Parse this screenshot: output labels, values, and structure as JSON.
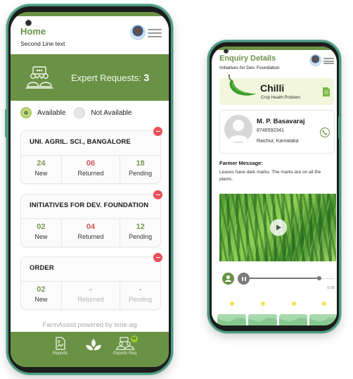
{
  "home_screen": {
    "header": {
      "title": "Home",
      "subtitle": "Second Line text",
      "avatar_icon": "user-avatar",
      "menu_icon": "hamburger-menu-icon"
    },
    "banner": {
      "icon": "expert-group-icon",
      "label": "Expert Requests:",
      "count": "3"
    },
    "availability": {
      "options": [
        {
          "label": "Available",
          "selected": true
        },
        {
          "label": "Not Available",
          "selected": false
        }
      ]
    },
    "organizations": [
      {
        "name": "UNI. AGRIL. SCI., BANGALORE",
        "stats": [
          {
            "value": "24",
            "label": "New"
          },
          {
            "value": "06",
            "label": "Returned"
          },
          {
            "value": "18",
            "label": "Pending"
          }
        ]
      },
      {
        "name": "INITIATIVES FOR DEV. FOUNDATION",
        "stats": [
          {
            "value": "02",
            "label": "New"
          },
          {
            "value": "04",
            "label": "Returned"
          },
          {
            "value": "12",
            "label": "Pending"
          }
        ]
      },
      {
        "name": "ORDER",
        "stats": [
          {
            "value": "02",
            "label": "New"
          },
          {
            "value": "-",
            "label": "Returned"
          },
          {
            "value": "-",
            "label": "Pending"
          }
        ]
      }
    ],
    "footer_brand": "FarmAssist powered by tene-ag",
    "bottom_nav": [
      {
        "label": "Reports",
        "icon": "report-document-icon"
      },
      {
        "label": "",
        "icon": "leaves-icon"
      },
      {
        "label": "Experts Req",
        "icon": "experts-icon",
        "badge": "04"
      }
    ]
  },
  "enquiry_screen": {
    "header": {
      "title": "Enquiry Details",
      "subtitle": "Initiatives for Dev. Foundation",
      "avatar_icon": "user-avatar",
      "menu_icon": "hamburger-menu-icon"
    },
    "crop": {
      "name": "Chilli",
      "problem": "Crop Health Problem",
      "icon": "chilli-icon",
      "doc_icon": "document-icon"
    },
    "farmer": {
      "name": "M. P. Basavaraj",
      "phone": "8746592341",
      "location": "Raichur, Karnataka",
      "call_icon": "phone-icon"
    },
    "message": {
      "title": "Farmer Message:",
      "text": "Leaves have dark marks. The marks are on all the plants."
    },
    "video": {
      "play_icon": "play-icon"
    },
    "audio": {
      "time": "0.05",
      "progress": 0.82
    },
    "thumbnails": [
      {
        "icon": "image-placeholder-icon"
      },
      {
        "icon": "image-placeholder-icon"
      },
      {
        "icon": "image-placeholder-icon"
      },
      {
        "icon": "image-placeholder-icon"
      }
    ],
    "colors": {
      "primary_green": "#6a9245",
      "alert_red": "#e8505b",
      "crop_card_bg": "#f1f6dd"
    }
  }
}
